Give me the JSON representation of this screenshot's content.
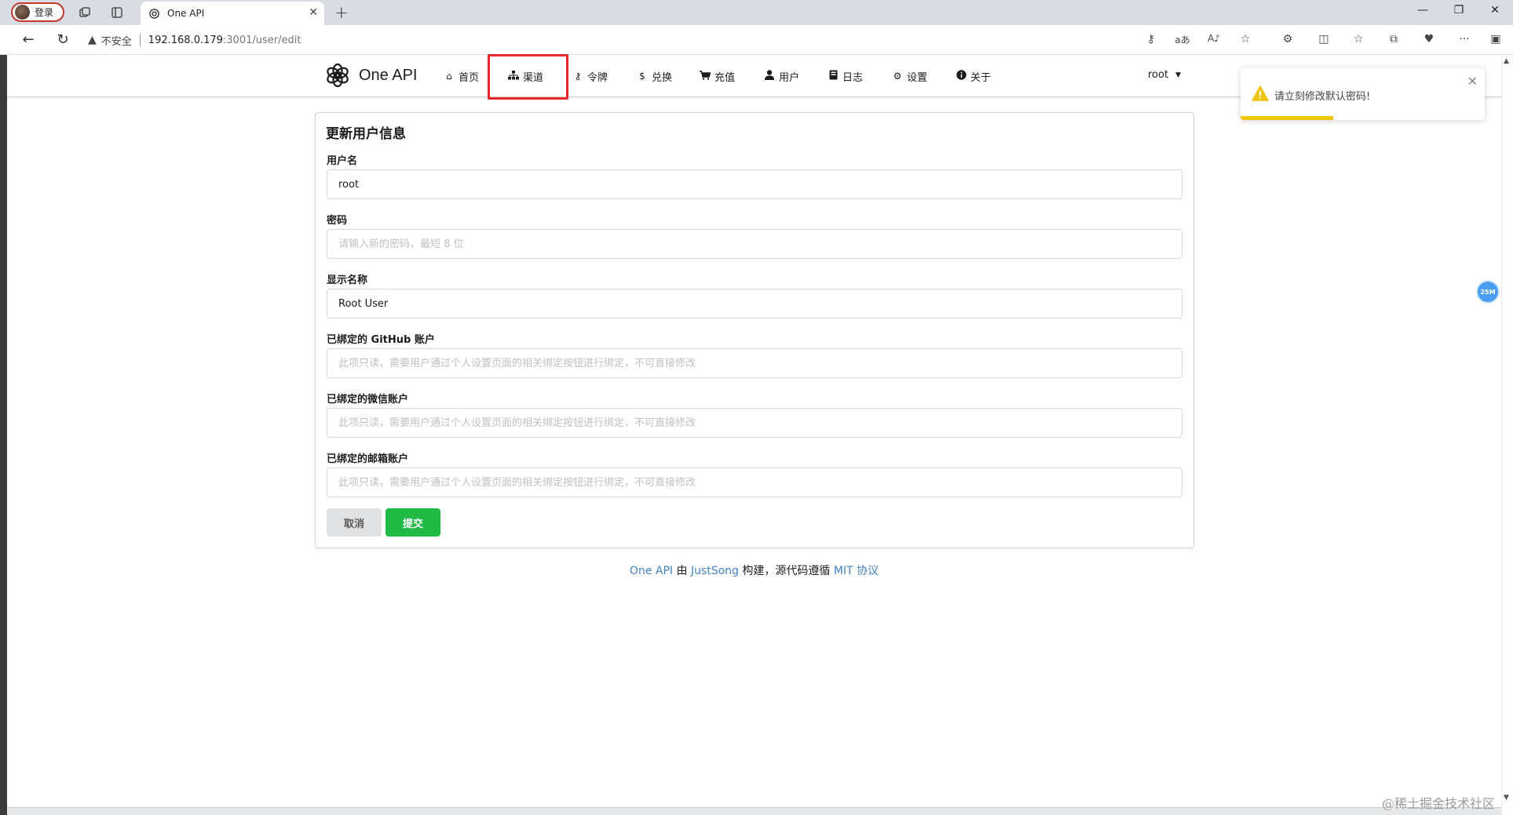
{
  "browser": {
    "profile_label": "登录",
    "tab_title": "One API",
    "new_tab_icon": "plus-icon",
    "security_label": "不安全",
    "url_host": "192.168.0.179",
    "url_path": ":3001/user/edit"
  },
  "app": {
    "brand": "One API",
    "menu": [
      {
        "label": "首页",
        "icon": "home-icon"
      },
      {
        "label": "渠道",
        "icon": "sitemap-icon"
      },
      {
        "label": "令牌",
        "icon": "key-icon"
      },
      {
        "label": "兑换",
        "icon": "dollar-icon"
      },
      {
        "label": "充值",
        "icon": "cart-icon"
      },
      {
        "label": "用户",
        "icon": "user-icon"
      },
      {
        "label": "日志",
        "icon": "book-icon"
      },
      {
        "label": "设置",
        "icon": "gear-icon"
      },
      {
        "label": "关于",
        "icon": "info-icon"
      }
    ],
    "current_user": "root",
    "highlight_color": "#e8262b"
  },
  "toast": {
    "message": "请立刻修改默认密码!",
    "progress": 0.38,
    "color": "#f1c40f"
  },
  "form": {
    "title": "更新用户信息",
    "username": {
      "label": "用户名",
      "value": "root"
    },
    "password": {
      "label": "密码",
      "value": "",
      "placeholder": "请输入新的密码，最短 8 位"
    },
    "display_name": {
      "label": "显示名称",
      "value": "Root User"
    },
    "github": {
      "label": "已绑定的 GitHub 账户",
      "value": "",
      "placeholder": "此项只读，需要用户通过个人设置页面的相关绑定按钮进行绑定，不可直接修改"
    },
    "wechat": {
      "label": "已绑定的微信账户",
      "value": "",
      "placeholder": "此项只读，需要用户通过个人设置页面的相关绑定按钮进行绑定，不可直接修改"
    },
    "email": {
      "label": "已绑定的邮箱账户",
      "value": "",
      "placeholder": "此项只读，需要用户通过个人设置页面的相关绑定按钮进行绑定，不可直接修改"
    },
    "cancel_label": "取消",
    "submit_label": "提交",
    "submit_color": "#21ba45"
  },
  "footer": {
    "brand_link": "One API",
    "by": " 由 ",
    "author_link": "JustSong",
    "middle": " 构建，源代码遵循 ",
    "license_link": "MIT 协议"
  },
  "side_badge": "25M",
  "watermark": "@稀土掘金技术社区"
}
